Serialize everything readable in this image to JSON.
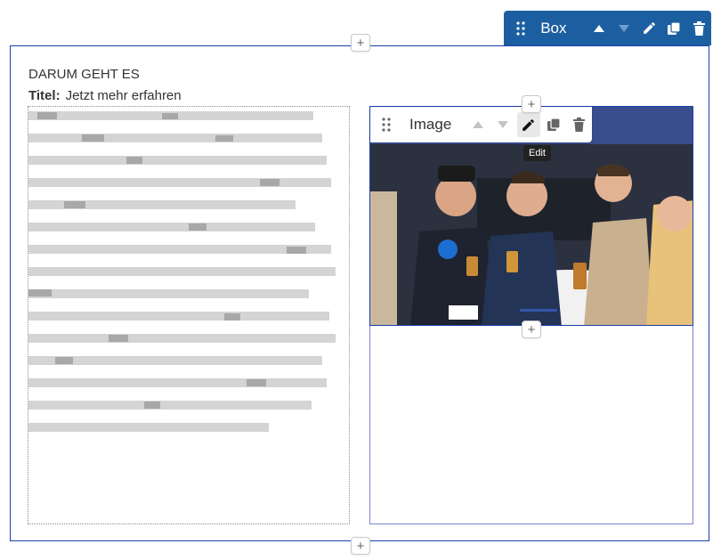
{
  "box_toolbar": {
    "label": "Box",
    "icons": [
      "drag-handle-icon",
      "arrow-up-icon",
      "arrow-down-icon",
      "pencil-icon",
      "duplicate-icon",
      "trash-icon"
    ],
    "background": "#1c5fa0"
  },
  "content": {
    "heading": "DARUM GEHT ES",
    "title_label": "Titel:",
    "title_value": "Jetzt mehr erfahren"
  },
  "image_toolbar": {
    "label": "Image",
    "tooltip": "Edit",
    "icons": [
      "drag-handle-icon",
      "arrow-up-icon",
      "arrow-down-icon",
      "pencil-icon",
      "duplicate-icon",
      "trash-icon"
    ]
  },
  "add_buttons": {
    "symbol": "+"
  },
  "colors": {
    "selection_border": "#1c3ea8",
    "column_border": "#7a86d0"
  }
}
